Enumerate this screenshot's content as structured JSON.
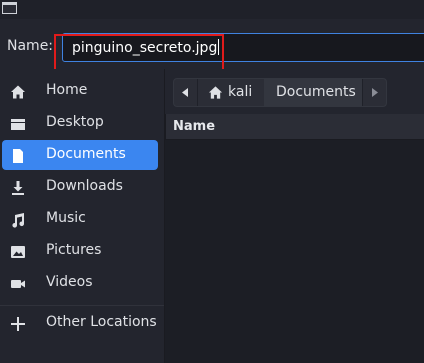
{
  "name_field": {
    "label": "Name:",
    "value": "pinguino_secreto.jpg"
  },
  "sidebar": {
    "items": [
      {
        "label": "Home",
        "icon": "home-icon"
      },
      {
        "label": "Desktop",
        "icon": "desktop-icon"
      },
      {
        "label": "Documents",
        "icon": "document-icon",
        "active": true
      },
      {
        "label": "Downloads",
        "icon": "download-icon"
      },
      {
        "label": "Music",
        "icon": "music-icon"
      },
      {
        "label": "Pictures",
        "icon": "picture-icon"
      },
      {
        "label": "Videos",
        "icon": "video-icon"
      }
    ],
    "other_locations": {
      "label": "Other Locations",
      "icon": "plus-icon"
    }
  },
  "pathbar": {
    "home": "kali",
    "current": "Documents"
  },
  "file_list": {
    "column_name": "Name"
  },
  "colors": {
    "accent": "#3b86f0",
    "highlight_box": "#e01b1b"
  }
}
